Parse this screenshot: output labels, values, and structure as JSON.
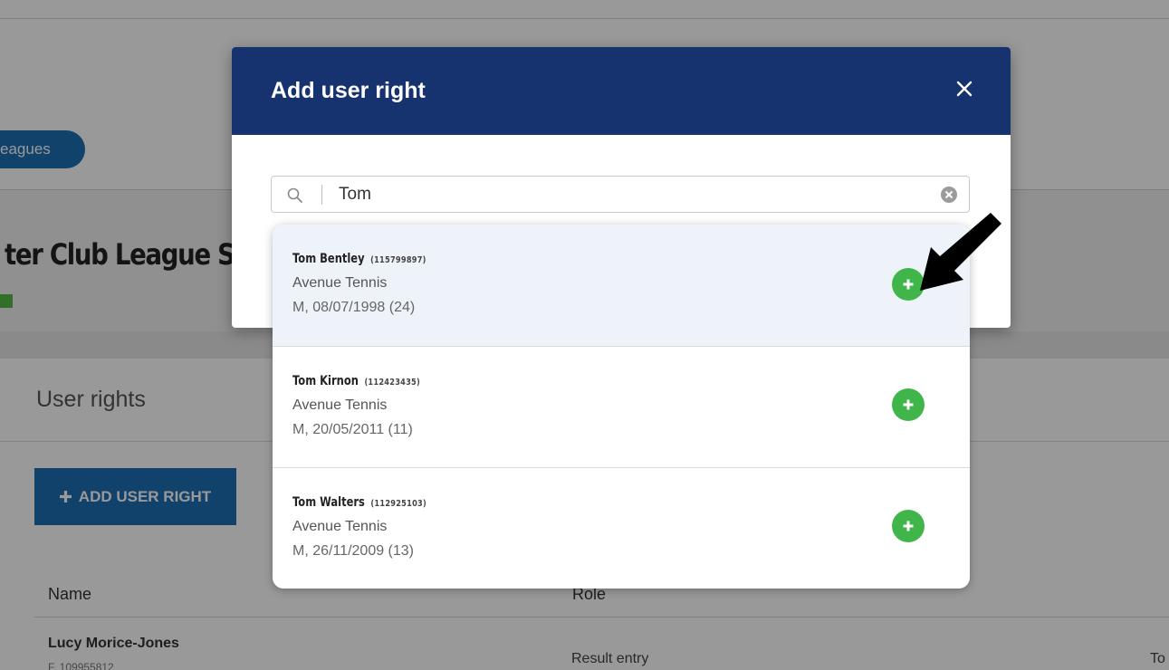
{
  "background": {
    "tab_label": "eagues",
    "league_title": "ter Club League S",
    "section_title": "User rights",
    "add_button_label": "ADD USER RIGHT",
    "table": {
      "headers": [
        "Name",
        "Role"
      ],
      "rows": [
        {
          "name": "Lucy Morice-Jones",
          "sub": "F, 109955812",
          "role": "Result entry",
          "extra": "To"
        }
      ]
    }
  },
  "modal": {
    "title": "Add user right",
    "search": {
      "value": "Tom"
    },
    "results": [
      {
        "name": "Tom Bentley",
        "id": "(115799897)",
        "club": "Avenue Tennis",
        "meta": "M, 08/07/1998 (24)"
      },
      {
        "name": "Tom Kirnon",
        "id": "(112423435)",
        "club": "Avenue Tennis",
        "meta": "M, 20/05/2011 (11)"
      },
      {
        "name": "Tom Walters",
        "id": "(112925103)",
        "club": "Avenue Tennis",
        "meta": "M, 26/11/2009 (13)"
      }
    ]
  },
  "colors": {
    "header": "#17336f",
    "primary_button": "#1d6fb2",
    "add_green": "#3fb54a"
  },
  "icons": [
    "search-icon",
    "clear-icon",
    "close-icon",
    "plus-icon",
    "pointer-arrow-icon"
  ]
}
